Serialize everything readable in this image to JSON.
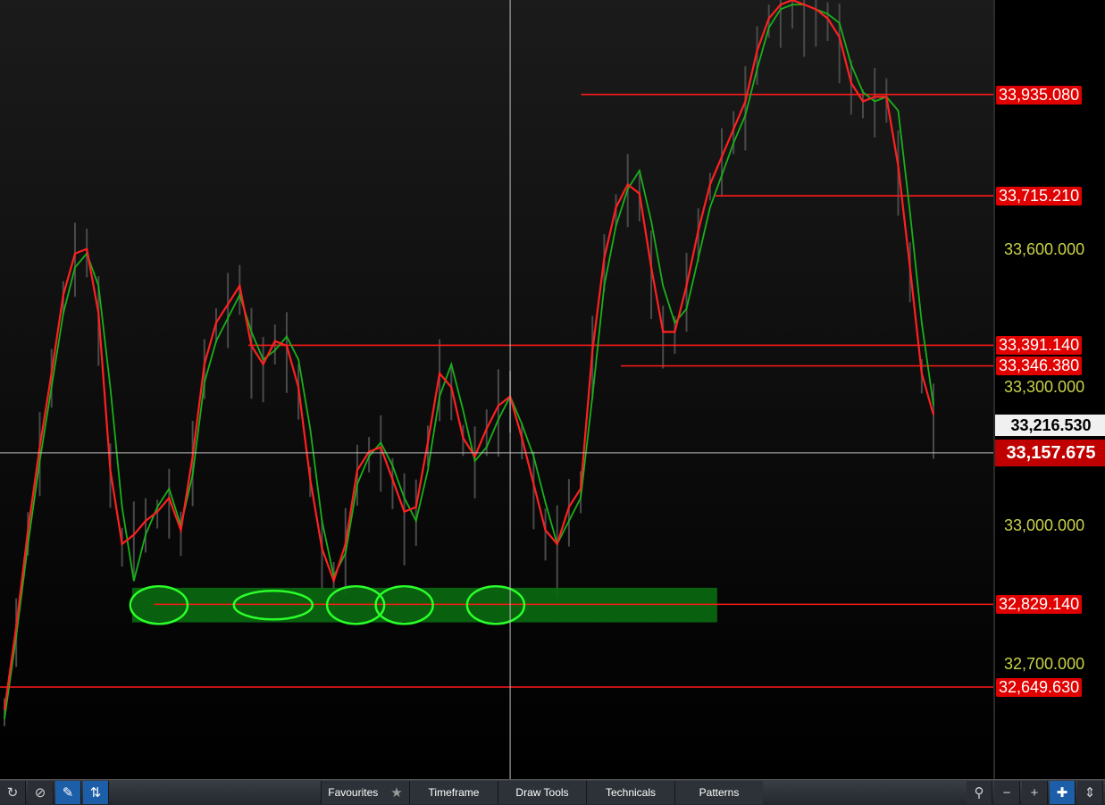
{
  "chart_data": {
    "type": "line",
    "y_range": [
      32450,
      34140
    ],
    "crosshair": {
      "x_index": 43,
      "y": 33157.675
    },
    "series": [
      {
        "color": "#19b019",
        "values": [
          32580,
          32760,
          32960,
          33140,
          33300,
          33460,
          33560,
          33590,
          33520,
          33300,
          33040,
          32880,
          32980,
          33040,
          33080,
          33000,
          33110,
          33310,
          33400,
          33450,
          33500,
          33420,
          33360,
          33380,
          33410,
          33360,
          33210,
          33010,
          32890,
          32940,
          33090,
          33150,
          33180,
          33130,
          33060,
          33010,
          33120,
          33280,
          33350,
          33250,
          33140,
          33170,
          33230,
          33280,
          33220,
          33150,
          33050,
          32960,
          33010,
          33060,
          33280,
          33520,
          33650,
          33730,
          33770,
          33660,
          33520,
          33440,
          33470,
          33580,
          33690,
          33760,
          33830,
          33890,
          33990,
          34080,
          34120,
          34130,
          34130,
          34120,
          34110,
          34090,
          34000,
          33940,
          33920,
          33930,
          33900,
          33680,
          33440,
          33260
        ]
      },
      {
        "color": "#ff2020",
        "values": [
          32600,
          32780,
          32990,
          33170,
          33330,
          33500,
          33590,
          33600,
          33460,
          33120,
          32960,
          32980,
          33010,
          33030,
          33060,
          32990,
          33150,
          33350,
          33440,
          33480,
          33520,
          33390,
          33350,
          33400,
          33390,
          33300,
          33100,
          32950,
          32880,
          32960,
          33120,
          33160,
          33170,
          33100,
          33030,
          33040,
          33180,
          33330,
          33300,
          33190,
          33150,
          33210,
          33260,
          33280,
          33190,
          33090,
          32990,
          32960,
          33040,
          33080,
          33380,
          33580,
          33690,
          33740,
          33720,
          33560,
          33420,
          33420,
          33520,
          33640,
          33740,
          33800,
          33860,
          33920,
          34030,
          34100,
          34130,
          34140,
          34130,
          34120,
          34100,
          34060,
          33960,
          33920,
          33930,
          33930,
          33780,
          33560,
          33330,
          33240
        ]
      }
    ],
    "levels": [
      {
        "label": "33,935.080",
        "value": 33935.08,
        "from": 0.585
      },
      {
        "label": "33,715.210",
        "value": 33715.21,
        "from": 0.72
      },
      {
        "label": "33,391.140",
        "value": 33391.14,
        "from": 0.25
      },
      {
        "label": "33,346.380",
        "value": 33346.38,
        "from": 0.625
      },
      {
        "label": "32,829.140",
        "value": 32829.14,
        "from": 0.155
      },
      {
        "label": "32,649.630",
        "value": 32649.63,
        "from": 0.0
      }
    ],
    "ticks": [
      {
        "label": "33,600.000",
        "value": 33600
      },
      {
        "label": "33,300.000",
        "value": 33300
      },
      {
        "label": "33,000.000",
        "value": 33000
      },
      {
        "label": "32,700.000",
        "value": 32700
      }
    ],
    "support_zone": {
      "low": 32790,
      "high": 32865,
      "from": 0.133,
      "to": 0.722
    },
    "circled_touches": [
      0.16,
      0.275,
      0.358,
      0.407,
      0.499
    ],
    "current_price": {
      "label": "33,216.530",
      "value": 33216.53
    },
    "last_price": {
      "label": "33,157.675",
      "value": 33157.675
    }
  },
  "toolbar": {
    "refresh_icon": "refresh-icon",
    "block_icon": "no-entry-icon",
    "pencil_icon": "pencil-icon",
    "arrows_icon": "up-down-arrows-icon",
    "menus": [
      "Favourites",
      "Timeframe",
      "Draw Tools",
      "Technicals",
      "Patterns"
    ],
    "right_icons": [
      "tree-icon",
      "minus-icon",
      "plus-icon",
      "crosshair-icon",
      "vertical-expand-icon"
    ]
  }
}
